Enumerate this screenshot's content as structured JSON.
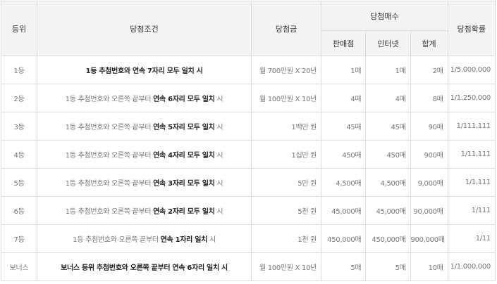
{
  "headers": {
    "rank": "등위",
    "condition": "당첨조건",
    "prize": "당첨금",
    "count_group": "당첨매수",
    "store": "판매점",
    "internet": "인터넷",
    "total": "합계",
    "probability": "당첨확률"
  },
  "rows": [
    {
      "rank": "1등",
      "cond_pre": "",
      "cond_bold": "1등 추첨번호와 연속 7자리 모두 일치",
      "cond_post": " 시",
      "prize": "월 700만원 X 20년",
      "store": "1매",
      "internet": "1매",
      "total": "2매",
      "prob": "1/5,000,000"
    },
    {
      "rank": "2등",
      "cond_pre": "1등 추첨번호와 오른쪽 끝부터 ",
      "cond_bold": "연속 6자리 모두 일치",
      "cond_post": " 시",
      "prize": "월 100만원 X 10년",
      "store": "4매",
      "internet": "4매",
      "total": "8매",
      "prob": "1/1,250,000"
    },
    {
      "rank": "3등",
      "cond_pre": "1등 추첨번호와 오른쪽 끝부터 ",
      "cond_bold": "연속 5자리 모두 일치",
      "cond_post": " 시",
      "prize": "1백만 원",
      "store": "45매",
      "internet": "45매",
      "total": "90매",
      "prob": "1/111,111"
    },
    {
      "rank": "4등",
      "cond_pre": "1등 추첨번호와 오른쪽 끝부터 ",
      "cond_bold": "연속 4자리 모두 일치",
      "cond_post": " 시",
      "prize": "1십만 원",
      "store": "450매",
      "internet": "450매",
      "total": "900매",
      "prob": "1/11,111"
    },
    {
      "rank": "5등",
      "cond_pre": "1등 추첨번호와 오른쪽 끝부터 ",
      "cond_bold": "연속 3자리 모두 일치",
      "cond_post": " 시",
      "prize": "5만 원",
      "store": "4,500매",
      "internet": "4,500매",
      "total": "9,000매",
      "prob": "1/1,111"
    },
    {
      "rank": "6등",
      "cond_pre": "1등 추첨번호와 오른쪽 끝부터 ",
      "cond_bold": "연속 2자리 모두 일치",
      "cond_post": " 시",
      "prize": "5천 원",
      "store": "45,000매",
      "internet": "45,000매",
      "total": "90,000매",
      "prob": "1/111"
    },
    {
      "rank": "7등",
      "cond_pre": "1등 추첨번호와 오른쪽 끝부터 ",
      "cond_bold": "연속 1자리 일치",
      "cond_post": " 시",
      "prize": "1천 원",
      "store": "450,000매",
      "internet": "450,000매",
      "total": "900,000매",
      "prob": "1/11"
    },
    {
      "rank": "보너스",
      "cond_pre": "",
      "cond_bold": "보너스 등위 추첨번호와 오른쪽 끝부터 연속 6자리 일치",
      "cond_post": " 시",
      "prize": "월 100만원 X 10년",
      "store": "5매",
      "internet": "5매",
      "total": "10매",
      "prob": "1/1,000,000"
    }
  ]
}
